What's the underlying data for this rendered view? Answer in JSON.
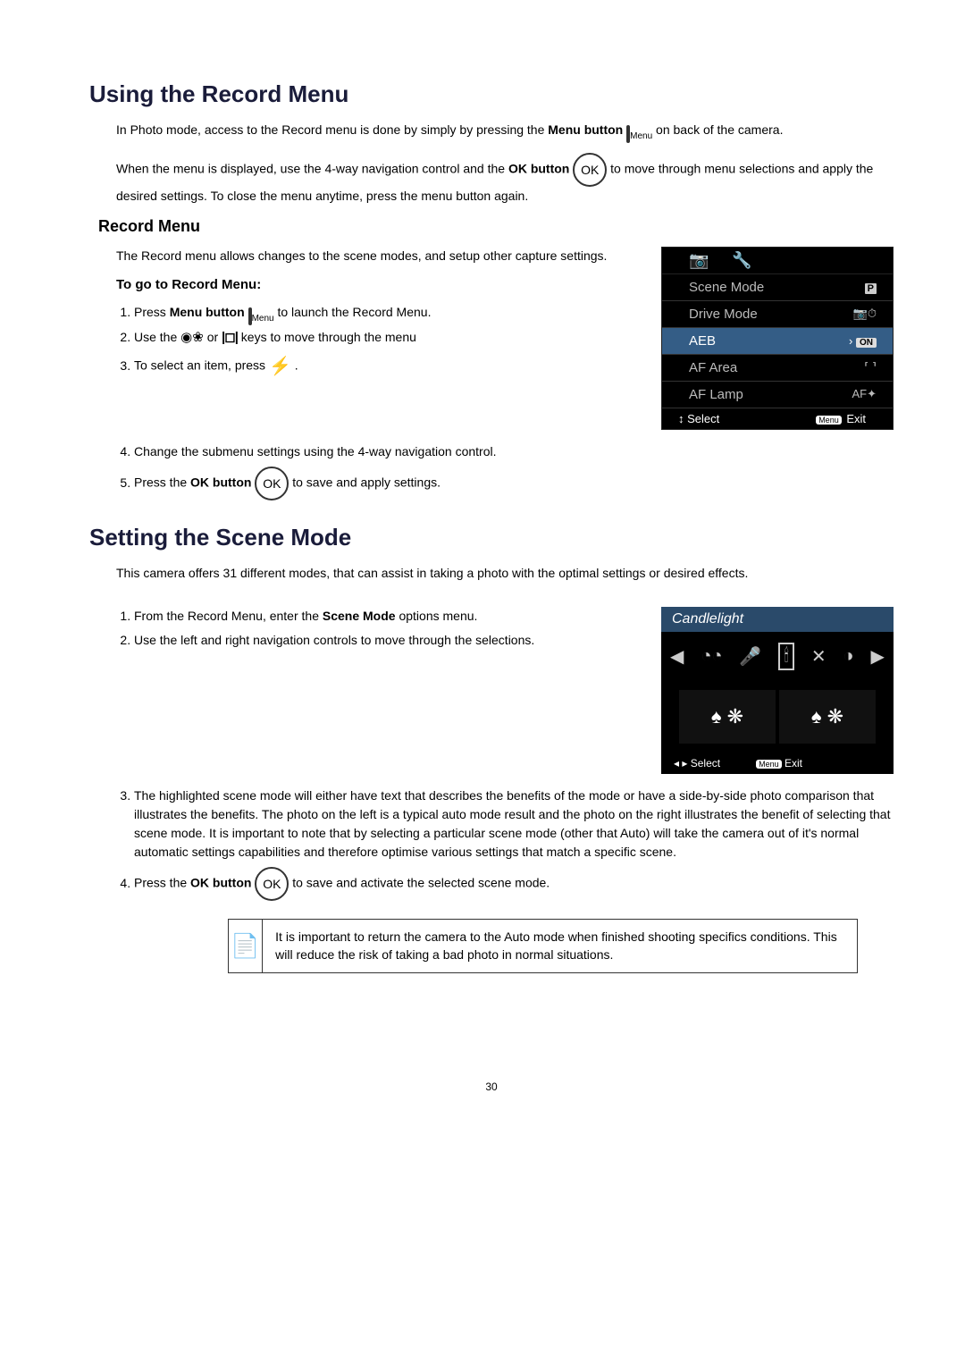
{
  "h1_a": "Using the Record Menu",
  "intro_a1": "In Photo mode, access to the Record menu is done by simply by pressing the ",
  "intro_a_bold": "Menu button",
  "menu_lbl": "Menu",
  "intro_a2": " on back of the camera.",
  "intro_b1": "When the menu is displayed, use the 4-way navigation control and the ",
  "intro_b_bold": "OK button",
  "ok_lbl": "OK",
  "intro_b2": " to move through menu selections and apply the desired settings. To close the menu anytime, press the menu button again.",
  "h2_record": "Record Menu",
  "record_desc": "The Record menu allows changes to the scene modes, and setup other capture settings.",
  "h3_goto": "To go to Record Menu:",
  "steps_a": {
    "s1a": "Press ",
    "s1_bold": "Menu button",
    "s1b": " to launch the Record Menu.",
    "s2a": "Use the ",
    "s2_macro": "◉❀",
    "s2_or": " or ",
    "s2_disp": "|◻|",
    "s2b": " keys to move through the menu",
    "s3a": "To select an item, press ",
    "s3_flash": "⚡",
    "s3b": ".",
    "s4": "Change the submenu settings using the 4-way navigation control.",
    "s5a": "Press the ",
    "s5_bold": "OK button",
    "s5b": " to save and apply settings."
  },
  "record_menu": {
    "tab1": "📷",
    "tab2": "🔧",
    "rows": [
      {
        "label": "Scene Mode",
        "val": "P",
        "type": "badge"
      },
      {
        "label": "Drive Mode",
        "val": "📷⏱",
        "type": "icon"
      },
      {
        "label": "AEB",
        "val": "ON",
        "hl": true,
        "prefix": "›",
        "type": "onbadge"
      },
      {
        "label": "AF Area",
        "val": "⸢ ⸣",
        "type": "icon"
      },
      {
        "label": "AF Lamp",
        "val": "AF✦",
        "type": "text"
      }
    ],
    "foot_left_arrows": "↕",
    "foot_left": "Select",
    "foot_menu_badge": "Menu",
    "foot_right": "Exit"
  },
  "h1_b": "Setting the Scene Mode",
  "scene_intro": "This camera offers 31 different modes, that can assist in taking a photo with the optimal settings or desired effects.",
  "steps_b": {
    "s1a": "From the Record Menu, enter the ",
    "s1_bold": "Scene Mode",
    "s1b": " options menu.",
    "s2": "Use the left and right navigation controls to move through the selections.",
    "s3": "The highlighted scene mode will either have text that describes the benefits of the mode or have a side-by-side photo comparison that illustrates the benefits. The photo on the left is a typical auto mode result and the photo on the right illustrates the benefit of selecting that scene mode. It is important to note that by selecting a particular scene mode (other that Auto) will take the camera out of it's normal automatic settings capabilities and therefore optimise various settings that match a specific scene.",
    "s4a": "Press the ",
    "s4_bold": "OK button",
    "s4b": " to save and activate the selected scene mode."
  },
  "scene_screen": {
    "title": "Candlelight",
    "arrow_l": "◀",
    "arrow_r": "▶",
    "icons": [
      "◔◔",
      "🎤",
      "🕯",
      "✕",
      "◑"
    ],
    "prev_a": "♠ ❋",
    "prev_b": "♠ ❋",
    "foot_l_arrows": "◂ ▸",
    "foot_l": "Select",
    "foot_menu_badge": "Menu",
    "foot_r": "Exit"
  },
  "note": {
    "icon": "📄",
    "text": "It is important to return the camera to the Auto mode when finished shooting specifics conditions. This will reduce the risk of taking a bad photo in normal situations."
  },
  "page": "30"
}
